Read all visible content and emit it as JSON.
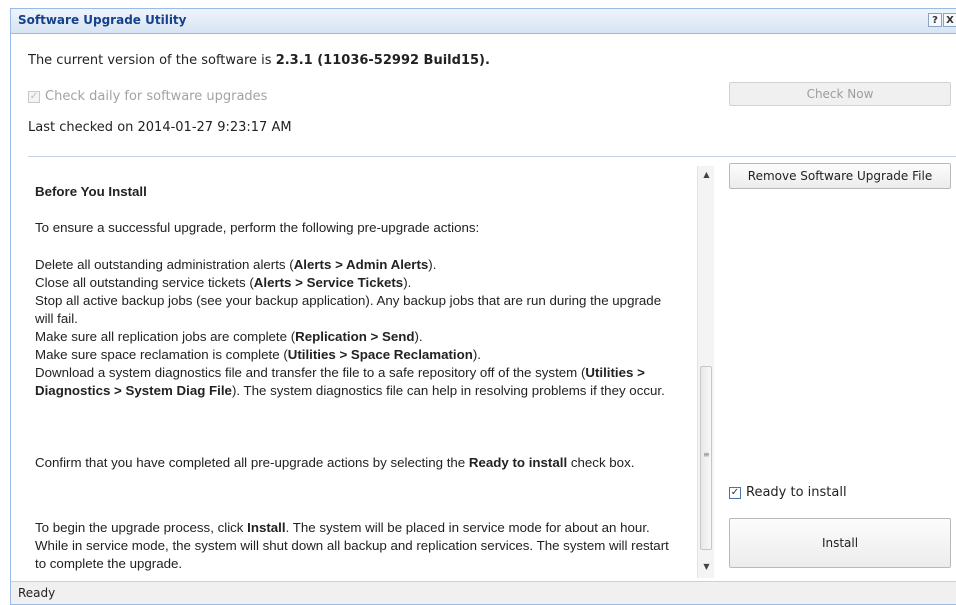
{
  "window": {
    "title": "Software Upgrade Utility",
    "help_icon": "?",
    "close_icon": "X"
  },
  "version": {
    "prefix": "The current version of the software is ",
    "value": "2.3.1 (11036-52992 Build15)."
  },
  "check_daily": {
    "label": "Check daily for software upgrades",
    "checked": true,
    "enabled": false
  },
  "last_checked": "Last checked on 2014-01-27 9:23:17 AM",
  "buttons": {
    "check_now": "Check Now",
    "remove_file": "Remove Software Upgrade File",
    "install": "Install"
  },
  "ready_to_install": {
    "label": "Ready to install",
    "checked": true
  },
  "content": {
    "heading": "Before You Install",
    "intro": "To ensure a successful upgrade, perform the following pre-upgrade actions:",
    "actions": [
      [
        "Delete all outstanding administration alerts (",
        "Alerts > Admin Alerts",
        ")."
      ],
      [
        "Close all outstanding service tickets (",
        "Alerts > Service Tickets",
        ")."
      ],
      [
        "Stop all active backup jobs (see your backup application). Any backup jobs that are run during the upgrade will fail.",
        "",
        ""
      ],
      [
        "Make sure all replication jobs are complete (",
        "Replication > Send",
        ")."
      ],
      [
        "Make sure space reclamation is complete (",
        "Utilities > Space Reclamation",
        ")."
      ],
      [
        "Download a system diagnostics file and transfer the file to a safe repository off of the system (",
        "Utilities > Diagnostics > System Diag File",
        "). The system diagnostics file can help in resolving problems if they occur."
      ]
    ],
    "confirm": [
      "Confirm that you have completed all pre-upgrade actions by selecting the ",
      "Ready to install",
      " check box."
    ],
    "begin": [
      "To begin the upgrade process, click ",
      "Install",
      ". The system will be placed in service mode for about an hour. While in service mode, the system will shut down all backup and replication services. The system will restart to complete the upgrade."
    ]
  },
  "scrollbar": {
    "up_icon": "▲",
    "down_icon": "▼",
    "grip_icon": "≡"
  },
  "status": "Ready"
}
